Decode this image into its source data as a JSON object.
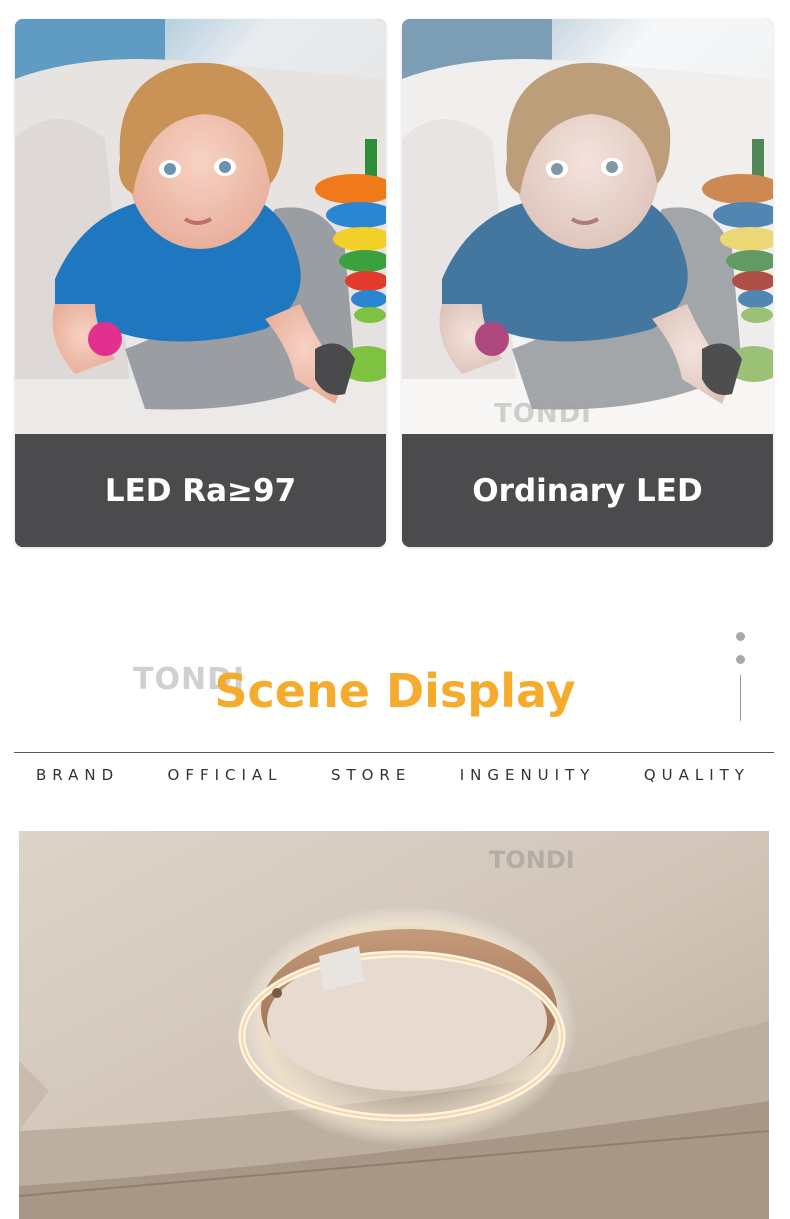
{
  "comparison": {
    "left_caption": "LED Ra≥97",
    "right_caption": "Ordinary LED",
    "watermark": "TONDI"
  },
  "section": {
    "watermark": "TONDI",
    "title": "Scene Display",
    "tagline": [
      "BRAND",
      "OFFICIAL",
      "STORE",
      "INGENUITY",
      "QUALITY"
    ]
  },
  "scene": {
    "watermark": "TONDI"
  },
  "colors": {
    "accent": "#f5ab2c",
    "caption_bg": "#4b4b4d"
  }
}
